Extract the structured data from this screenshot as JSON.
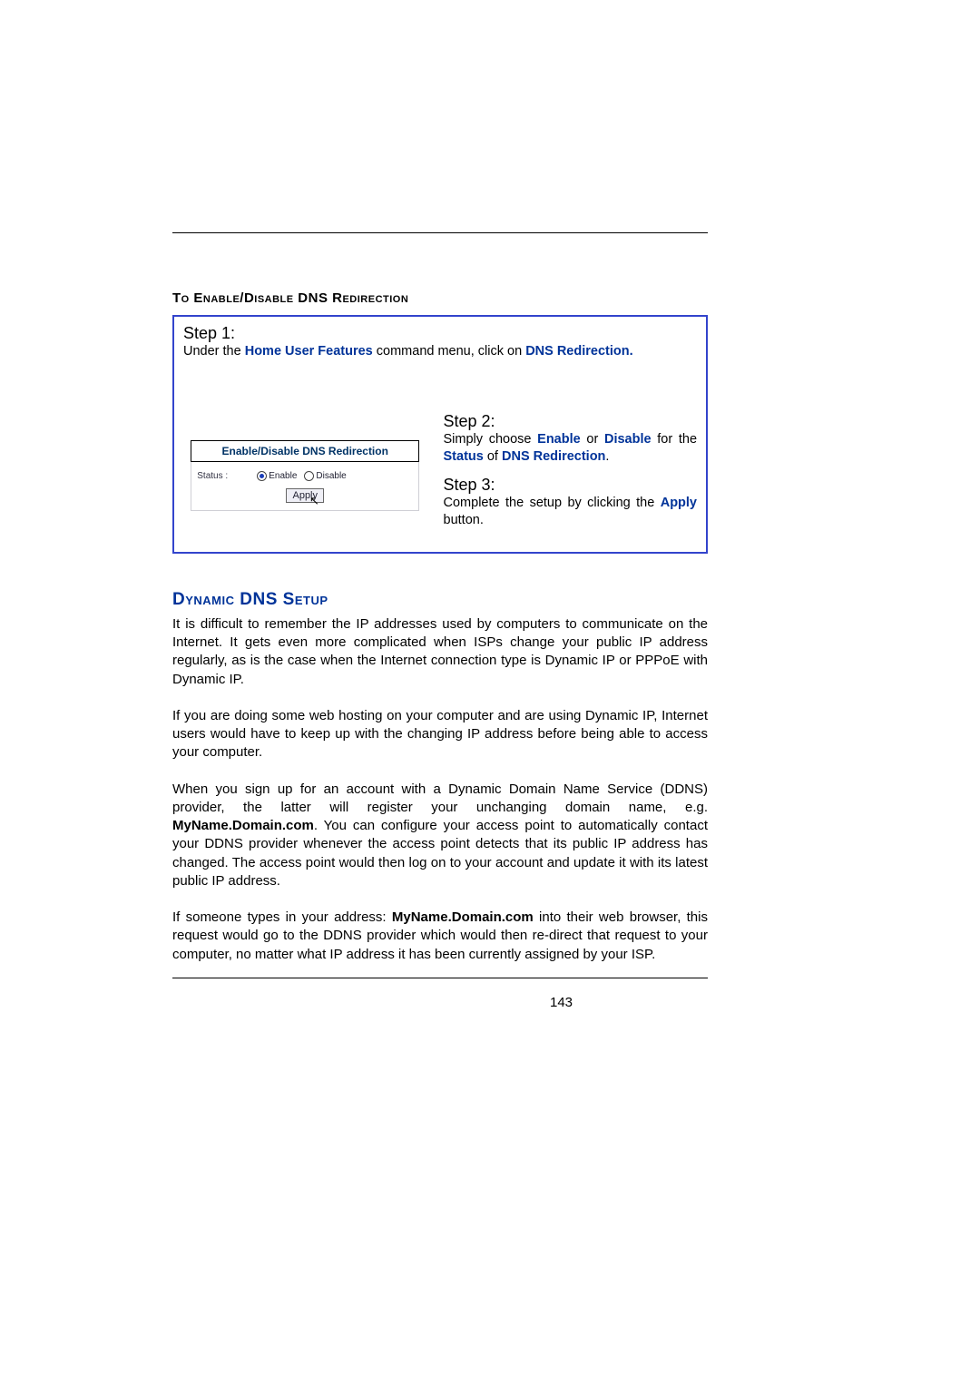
{
  "heading1": "To Enable/Disable DNS Redirection",
  "step1": {
    "label": "Step 1:",
    "pre": "Under the ",
    "bold1": "Home User Features",
    "mid": " command menu, click on ",
    "bold2": "DNS Redirection."
  },
  "screenshot": {
    "title": "Enable/Disable DNS Redirection",
    "statusLabel": "Status :",
    "enable": "Enable",
    "disable": "Disable",
    "apply": "Apply"
  },
  "step2": {
    "label": "Step 2:",
    "t1": "Simply choose ",
    "enable": "Enable",
    "or": " or ",
    "disable": "Disable",
    "for": " for the ",
    "status": "Status",
    "of": " of ",
    "dnsr": "DNS Redirection",
    "dot": "."
  },
  "step3": {
    "label": "Step 3:",
    "t1": "Complete the setup by clicking the ",
    "apply": "Apply",
    "t2": " button."
  },
  "heading2": "Dynamic DNS Setup",
  "para1": "It is difficult to remember the IP addresses used by computers to communicate on the Internet. It gets even more complicated when ISPs change your public IP address regularly, as is the case when the Internet connection type is Dynamic IP or PPPoE with Dynamic IP.",
  "para2": "If you are doing some web hosting on your computer and are using Dynamic IP, Internet users would have to keep up with the changing IP address before being able to access your computer.",
  "para3a": "When you sign up for an account with a Dynamic Domain Name Service (DDNS) provider, the latter will register your unchanging domain name, e.g. ",
  "para3bold": "MyName.Domain.com",
  "para3b": ". You can configure your access point to automatically contact your DDNS provider whenever the access point detects that its public IP address has changed. The access point would then log on to your account and update it with its latest public IP address.",
  "para4a": "If someone types in your address: ",
  "para4bold": "MyName.Domain.com",
  "para4b": " into their web browser, this request would go to the DDNS provider which would then re-direct that request to your computer, no matter what IP address it has been currently assigned by your ISP.",
  "pageNumber": "143"
}
